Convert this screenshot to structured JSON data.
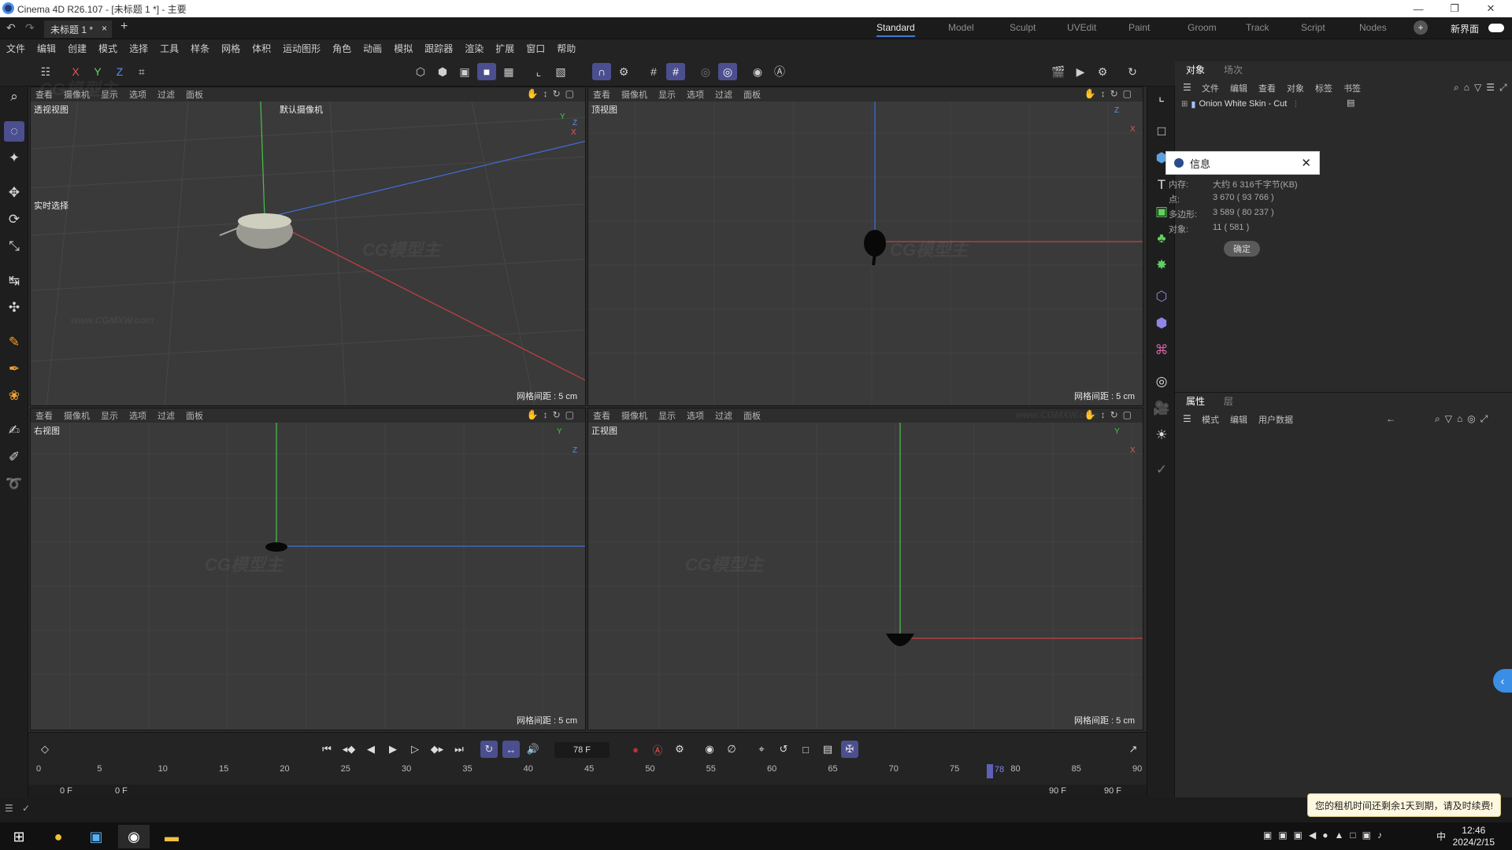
{
  "window": {
    "title": "Cinema 4D R26.107 - [未标题 1 *] - 主要"
  },
  "doc_tab": {
    "label": "未标题 1 *",
    "close": "×",
    "add": "+"
  },
  "layouts": {
    "items": [
      "Standard",
      "Model",
      "Sculpt",
      "UVEdit",
      "Paint",
      "Groom",
      "Track",
      "Script",
      "Nodes"
    ],
    "active": "Standard",
    "new_layout": "新界面"
  },
  "menu": [
    "文件",
    "编辑",
    "创建",
    "模式",
    "选择",
    "工具",
    "样条",
    "网格",
    "体积",
    "运动图形",
    "角色",
    "动画",
    "模拟",
    "跟踪器",
    "渲染",
    "扩展",
    "窗口",
    "帮助"
  ],
  "toolbar": {
    "axis_x": "X",
    "axis_y": "Y",
    "axis_z": "Z"
  },
  "viewport_menu": [
    "查看",
    "摄像机",
    "显示",
    "选项",
    "过滤",
    "面板"
  ],
  "viewports": {
    "perspective": {
      "name": "透视视图",
      "camera": "默认摄像机",
      "grid": "网格间距 : 5 cm",
      "realtime": "实时选择"
    },
    "top": {
      "name": "顶视图",
      "grid": "网格间距 : 5 cm"
    },
    "right": {
      "name": "右视图",
      "grid": "网格间距 : 5 cm"
    },
    "front": {
      "name": "正视图",
      "grid": "网格间距 : 5 cm"
    }
  },
  "axis_labels": {
    "x": "X",
    "y": "Y",
    "z": "Z"
  },
  "watermark": {
    "logo": "CG模型主",
    "url": "www.CGMXW.com"
  },
  "timeline": {
    "current_frame": "78 F",
    "ruler": [
      "0",
      "5",
      "10",
      "15",
      "20",
      "25",
      "30",
      "35",
      "40",
      "45",
      "50",
      "55",
      "60",
      "65",
      "70",
      "75",
      "80",
      "85",
      "90"
    ],
    "playhead": "78",
    "playhead_fraction": 0.867,
    "start": "0 F",
    "start2": "0 F",
    "end": "90 F",
    "end2": "90 F"
  },
  "object_panel": {
    "tabs": [
      "对象",
      "场次"
    ],
    "menu": [
      "文件",
      "编辑",
      "查看",
      "对象",
      "标签",
      "书签"
    ],
    "object_name": "Onion White Skin - Cut"
  },
  "info_dialog": {
    "title": "信息",
    "rows": [
      {
        "label": "内存:",
        "value": "大约 6 316千字节(KB)"
      },
      {
        "label": "点:",
        "value": "3 670 ( 93 766 )"
      },
      {
        "label": "多边形:",
        "value": "3 589 ( 80 237 )"
      },
      {
        "label": "对象:",
        "value": "11 ( 581 )"
      }
    ],
    "ok": "确定"
  },
  "attr_panel": {
    "tabs": [
      "属性",
      "层"
    ],
    "menu": [
      "模式",
      "编辑",
      "用户数据"
    ]
  },
  "promo": {
    "text": "您的租机时间还剩余1天到期，请及时续费!"
  },
  "taskbar": {
    "time": "12:46",
    "date": "2024/2/15",
    "ime": "中"
  }
}
